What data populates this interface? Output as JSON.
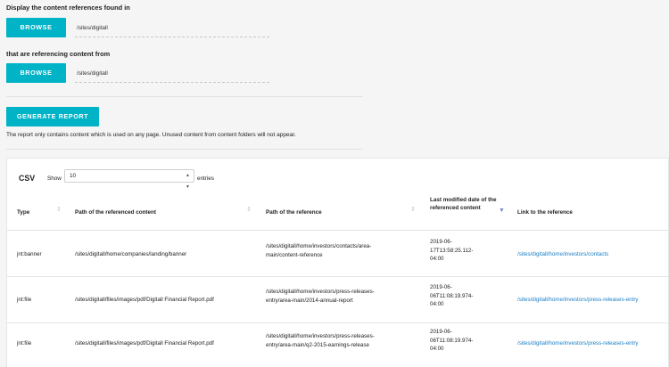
{
  "form": {
    "label_found_in": "Display the content references found in",
    "browse1_label": "BROWSE",
    "path1": "/sites/digitall",
    "label_referencing": "that are referencing content from",
    "browse2_label": "BROWSE",
    "path2": "/sites/digitall",
    "generate_label": "GENERATE REPORT",
    "note": "The report only contains content which is used on any page. Unused content from content folders will not appear."
  },
  "table_controls": {
    "csv_label": "CSV",
    "show_label": "Show",
    "entries_value": "10",
    "entries_label": "entries"
  },
  "table": {
    "columns": [
      "Type",
      "Path of the referenced content",
      "Path of the reference",
      "Last modified date of the referenced content",
      "Link to the reference"
    ],
    "rows": [
      {
        "type": "jnt:banner",
        "ref_content": "/sites/digitall/home/companies/landing/banner",
        "reference_l1": "/sites/digitall/home/investors/contacts/area-",
        "reference_l2": "main/content-reference",
        "date_l1": "2019-06-",
        "date_l2": "17T13:58:25.112-",
        "date_l3": "04:00",
        "link": "/sites/digitall/home/investors/contacts"
      },
      {
        "type": "jnt:file",
        "ref_content": "/sites/digitall/files/images/pdf/Digitall Financial Report.pdf",
        "reference_l1": "/sites/digitall/home/investors/press-releases-",
        "reference_l2": "entry/area-main/2014-annual-report",
        "date_l1": "2019-06-",
        "date_l2": "06T11:08:19.974-",
        "date_l3": "04:00",
        "link": "/sites/digitall/home/investors/press-releases-entry"
      },
      {
        "type": "jnt:file",
        "ref_content": "/sites/digitall/files/images/pdf/Digitall Financial Report.pdf",
        "reference_l1": "/sites/digitall/home/investors/press-releases-",
        "reference_l2": "entry/area-main/q2-2015-earnings-release",
        "date_l1": "2019-06-",
        "date_l2": "06T11:08:19.974-",
        "date_l3": "04:00",
        "link": "/sites/digitall/home/investors/press-releases-entry"
      }
    ]
  }
}
